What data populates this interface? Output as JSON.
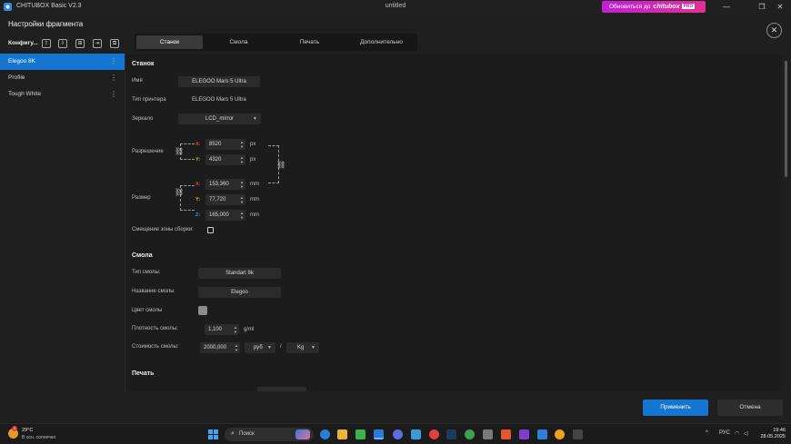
{
  "window": {
    "app_title": "CHITUBOX Basic V2.3",
    "doc_title": "untitled",
    "upgrade_prefix": "Обновиться до",
    "upgrade_brand": "chitubox",
    "upgrade_tag": "PRO",
    "min_glyph": "—",
    "max_glyph": "❐",
    "close_glyph": "✕"
  },
  "header": {
    "title": "Настройки фрагмента",
    "close_glyph": "✕"
  },
  "left_panel": {
    "label": "Конфигу...",
    "tools": [
      "⇪",
      "⇩",
      "⊞",
      "⇥",
      "⧉"
    ],
    "profiles": [
      {
        "name": "Elegoo 8K",
        "active": true
      },
      {
        "name": "Profile",
        "active": false
      },
      {
        "name": "Tough White",
        "active": false
      }
    ],
    "kebab": "⋮"
  },
  "tabs": [
    {
      "label": "Станок",
      "active": true
    },
    {
      "label": "Смола",
      "active": false
    },
    {
      "label": "Печать",
      "active": false
    },
    {
      "label": "Дополнительно",
      "active": false
    }
  ],
  "machine": {
    "section_title": "Станок",
    "name_label": "Имя",
    "name_value": "ELEGOO Mars 5 Ultra",
    "printer_type_label": "Тип принтера",
    "printer_type_value": "ELEGOO Mars 5 Ultra",
    "mirror_label": "Зеркало",
    "mirror_value": "LCD_mirror",
    "resolution_label": "Разрешение",
    "res_x_axis": "X:",
    "res_x": "8520",
    "res_x_unit": "px",
    "res_y_axis": "Y:",
    "res_y": "4320",
    "res_y_unit": "px",
    "size_label": "Размер",
    "size_x_axis": "X:",
    "size_x": "153,360",
    "size_x_unit": "mm",
    "size_y_axis": "Y:",
    "size_y": "77,720",
    "size_y_unit": "mm",
    "size_z_axis": "Z:",
    "size_z": "165,000",
    "size_z_unit": "mm",
    "offset_label": "Смещение зоны сборки:"
  },
  "resin": {
    "section_title": "Смола",
    "type_label": "Тип смолы:",
    "type_value": "Standart 8k",
    "name_label": "Название смолы",
    "name_value": "Elegoo",
    "color_label": "Цвет смолы",
    "color_hex": "#8c8c8c",
    "density_label": "Плотность смолы:",
    "density_value": "1,100",
    "density_unit": "g/ml",
    "cost_label": "Стоимость смолы:",
    "cost_value": "2000,000",
    "currency": "руб",
    "slash": "/",
    "weight_unit": "Kg"
  },
  "print": {
    "section_title": "Печать"
  },
  "footer": {
    "apply_label": "Применить",
    "cancel_label": "Отмена"
  },
  "taskbar": {
    "temp": "29°C",
    "weather_desc": "В осн. солнечно",
    "badge": "1",
    "search_placeholder": "Поиск",
    "tray_lang": "РУС",
    "tray_chevron": "^",
    "time": "19:46",
    "date": "28.05.2025",
    "accent": "#1576d2"
  }
}
